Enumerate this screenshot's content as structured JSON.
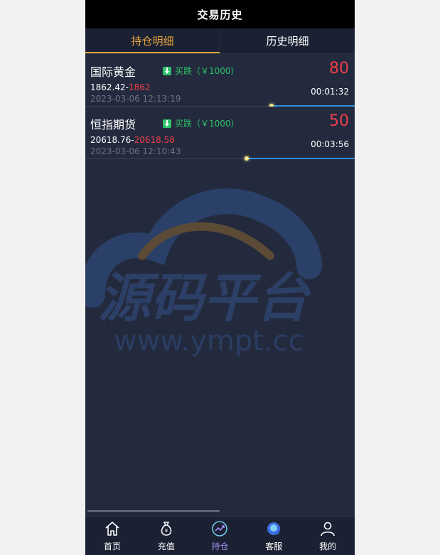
{
  "header": {
    "title": "交易历史"
  },
  "tabs": [
    {
      "label": "持仓明细",
      "active": true
    },
    {
      "label": "历史明细",
      "active": false
    }
  ],
  "positions": [
    {
      "name": "国际黄金",
      "direction": "买跌（￥1000）",
      "open_price": "1862.42-",
      "current_price": "1862",
      "time": "2023-03-06 12:13:19",
      "score": "80",
      "timer": "00:01:32",
      "progress": 0.31
    },
    {
      "name": "恒指期货",
      "direction": "买跌（￥1000）",
      "open_price": "20618.76-",
      "current_price": "20618.58",
      "time": "2023-03-06 12:10:43",
      "score": "50",
      "timer": "00:03:56",
      "progress": 0.4
    }
  ],
  "watermark": {
    "title": "源码平台",
    "url": "www.ympt.cc"
  },
  "nav": [
    {
      "label": "首页",
      "icon": "home-icon",
      "active": false
    },
    {
      "label": "充值",
      "icon": "money-bag-icon",
      "active": false
    },
    {
      "label": "持仓",
      "icon": "chart-trend-icon",
      "active": true
    },
    {
      "label": "客服",
      "icon": "customer-service-icon",
      "active": false
    },
    {
      "label": "我的",
      "icon": "user-icon",
      "active": false
    }
  ],
  "colors": {
    "accent": "#e8a33d",
    "loss": "#ee3d4a",
    "green": "#2fc26a",
    "progress": "#2d8ee0",
    "nav_active": "#a28df0"
  }
}
